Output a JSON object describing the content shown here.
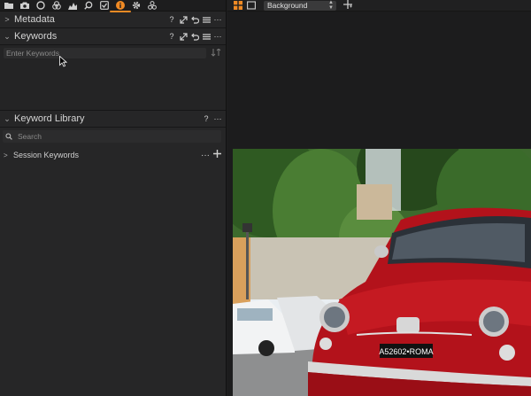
{
  "toolbar": {
    "tools": [
      "folder-icon",
      "camera-icon",
      "circle-icon",
      "color-balance-icon",
      "histogram-icon",
      "search-icon",
      "checklist-icon",
      "info-icon",
      "gear-icon",
      "adjustments-icon"
    ],
    "active_tool": "info-icon",
    "accent_color": "#f08a24"
  },
  "sections": {
    "metadata": {
      "title": "Metadata",
      "chevron": ">"
    },
    "keywords": {
      "title": "Keywords",
      "chevron": "⌄",
      "input_placeholder": "Enter Keywords"
    },
    "library": {
      "title": "Keyword Library",
      "chevron": "⌄",
      "search_placeholder": "Search",
      "session_label": "Session Keywords",
      "session_chevron": ">"
    }
  },
  "header_tools": {
    "help": "?",
    "more": "···"
  },
  "viewer": {
    "background_select": "Background"
  },
  "photo": {
    "plate": "A52602•ROMA"
  }
}
